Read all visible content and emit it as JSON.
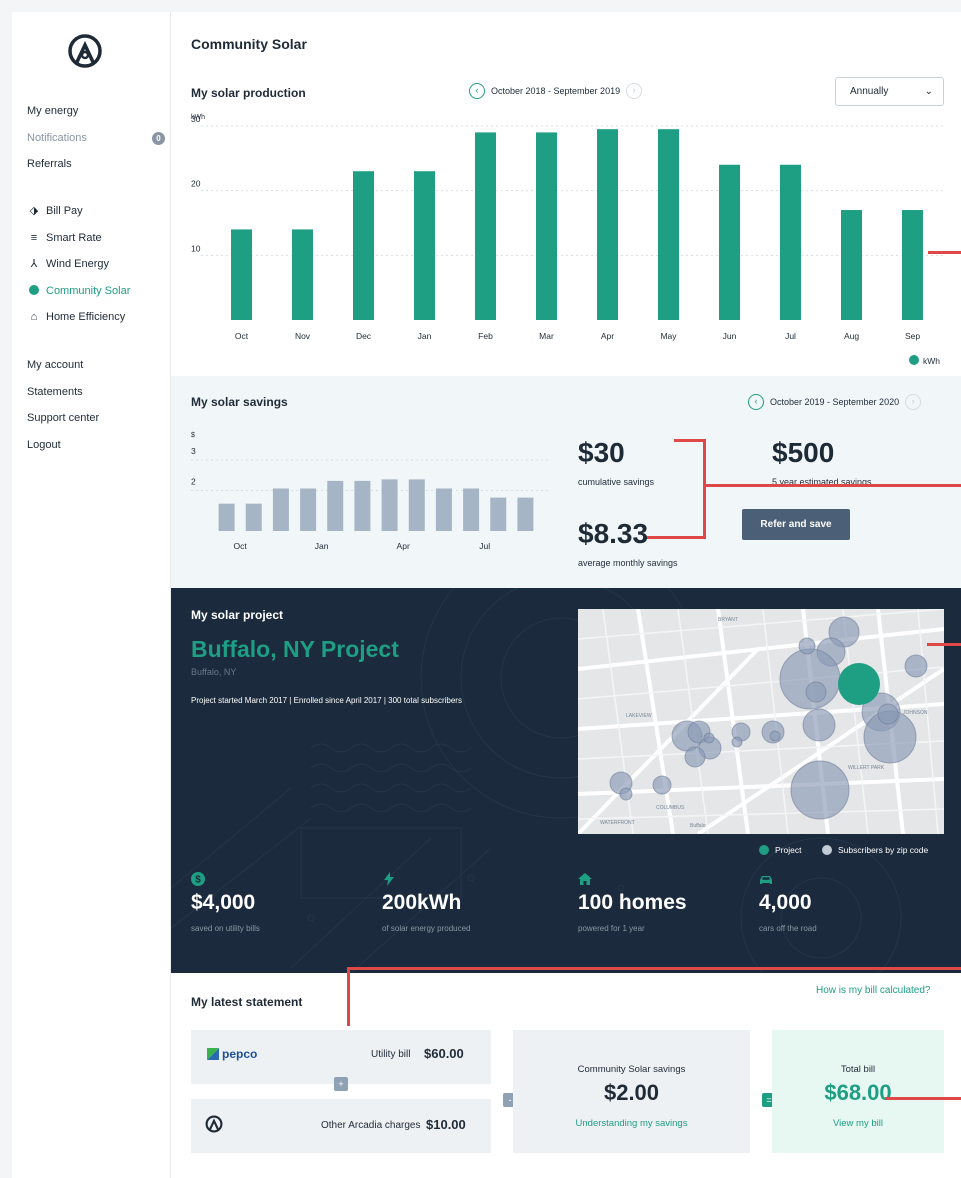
{
  "sidebar": {
    "nav_top": [
      {
        "label": "My energy"
      },
      {
        "label": "Notifications",
        "badge": "0"
      },
      {
        "label": "Referrals"
      }
    ],
    "nav_products": [
      {
        "label": "Bill Pay",
        "icon": "bill-pay-icon"
      },
      {
        "label": "Smart Rate",
        "icon": "smart-rate-icon"
      },
      {
        "label": "Wind Energy",
        "icon": "wind-icon"
      },
      {
        "label": "Community Solar",
        "icon": "solar-dot-icon"
      },
      {
        "label": "Home Efficiency",
        "icon": "home-icon"
      }
    ],
    "nav_account": [
      {
        "label": "My account"
      },
      {
        "label": "Statements"
      },
      {
        "label": "Support center"
      },
      {
        "label": "Logout"
      }
    ]
  },
  "page": {
    "title": "Community Solar"
  },
  "production": {
    "title": "My solar production",
    "period": "October 2018 - September 2019",
    "select_value": "Annually",
    "unit_label": "kWh",
    "legend_label": "kWh"
  },
  "savings": {
    "title": "My solar savings",
    "period": "October 2019 - September 2020",
    "unit_label": "$",
    "cumulative": "$30",
    "cumulative_label": "cumulative savings",
    "average": "$8.33",
    "average_label": "average monthly savings",
    "estimate": "$500",
    "estimate_label": "5 year estimated savings",
    "refer_button": "Refer and save"
  },
  "project": {
    "section_label": "My solar project",
    "name": "Buffalo, NY Project",
    "location": "Buffalo, NY",
    "info": "Project started March 2017  |  Enrolled since April 2017  |  300 total subscribers",
    "legend_project": "Project",
    "legend_subscribers": "Subscribers by zip code",
    "map_labels": [
      "BRYANT",
      "LAKEVIEW",
      "JOHNSON",
      "WILLERT PARK",
      "WATERFRONT",
      "COLUMBUS",
      "Buffalo"
    ],
    "stats": [
      {
        "value": "$4,000",
        "label": "saved on utility bills",
        "icon": "dollar-icon"
      },
      {
        "value": "200kWh",
        "label": "of solar energy produced",
        "icon": "bolt-icon"
      },
      {
        "value": "100 homes",
        "label": "powered for 1 year",
        "icon": "house-icon"
      },
      {
        "value": "4,000",
        "label": "cars off the road",
        "icon": "car-icon"
      }
    ]
  },
  "statement": {
    "title": "My latest statement",
    "link": "How is my bill calculated?",
    "provider": "pepco",
    "utility_label": "Utility bill",
    "utility_value": "$60.00",
    "other_label": "Other Arcadia charges",
    "other_value": "$10.00",
    "savings_label": "Community Solar savings",
    "savings_value": "$2.00",
    "savings_link": "Understanding my savings",
    "total_label": "Total bill",
    "total_value": "$68.00",
    "total_link": "View my bill",
    "op_plus": "+",
    "op_minus": "-",
    "op_equals": "="
  },
  "colors": {
    "accent": "#1e9e83",
    "navy": "#1b2a3c",
    "savings_bar": "#a6b5c6",
    "annotation": "#e04848"
  },
  "chart_data": [
    {
      "type": "bar",
      "title": "My solar production",
      "ylabel": "kWh",
      "categories": [
        "Oct",
        "Nov",
        "Dec",
        "Jan",
        "Feb",
        "Mar",
        "Apr",
        "May",
        "Jun",
        "Jul",
        "Aug",
        "Sep"
      ],
      "values": [
        14,
        14,
        23,
        23,
        29,
        29,
        29.5,
        29.5,
        24,
        24,
        17,
        17
      ],
      "yticks": [
        10,
        20,
        30
      ],
      "ylim": [
        0,
        32
      ],
      "grid": true,
      "legend": "bottom-right"
    },
    {
      "type": "bar",
      "title": "My solar savings",
      "ylabel": "$",
      "categories": [
        "Oct",
        "Nov",
        "Dec",
        "Jan",
        "Feb",
        "Mar",
        "Apr",
        "May",
        "Jun",
        "Jul",
        "Aug",
        "Sep"
      ],
      "xticks": [
        "Oct",
        "Jan",
        "Apr",
        "Jul"
      ],
      "values": [
        1.4,
        1.4,
        1.9,
        1.9,
        2.15,
        2.15,
        2.2,
        2.2,
        1.9,
        1.9,
        1.6,
        1.6
      ],
      "yticks": [
        2,
        3
      ],
      "ylim": [
        0.5,
        3.2
      ],
      "grid": true
    }
  ]
}
